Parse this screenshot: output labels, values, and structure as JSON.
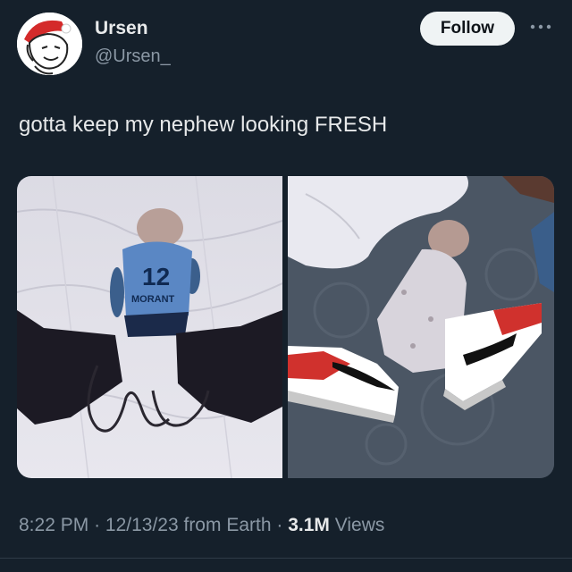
{
  "user": {
    "name": "Ursen",
    "handle": "@Ursen_"
  },
  "actions": {
    "follow_label": "Follow"
  },
  "tweet": {
    "text": "gotta keep my nephew looking FRESH"
  },
  "media": {
    "left_jersey_number": "12",
    "left_jersey_name": "MORANT"
  },
  "meta": {
    "time": "8:22 PM",
    "date": "12/13/23",
    "source": "from Earth",
    "views_count": "3.1M",
    "views_label": "Views"
  },
  "colors": {
    "background": "#15202b",
    "primary_text": "#e7e9ea",
    "secondary_text": "#8b98a5",
    "follow_button_bg": "#eff3f4"
  },
  "icons": {
    "more": "more-dots-icon"
  }
}
